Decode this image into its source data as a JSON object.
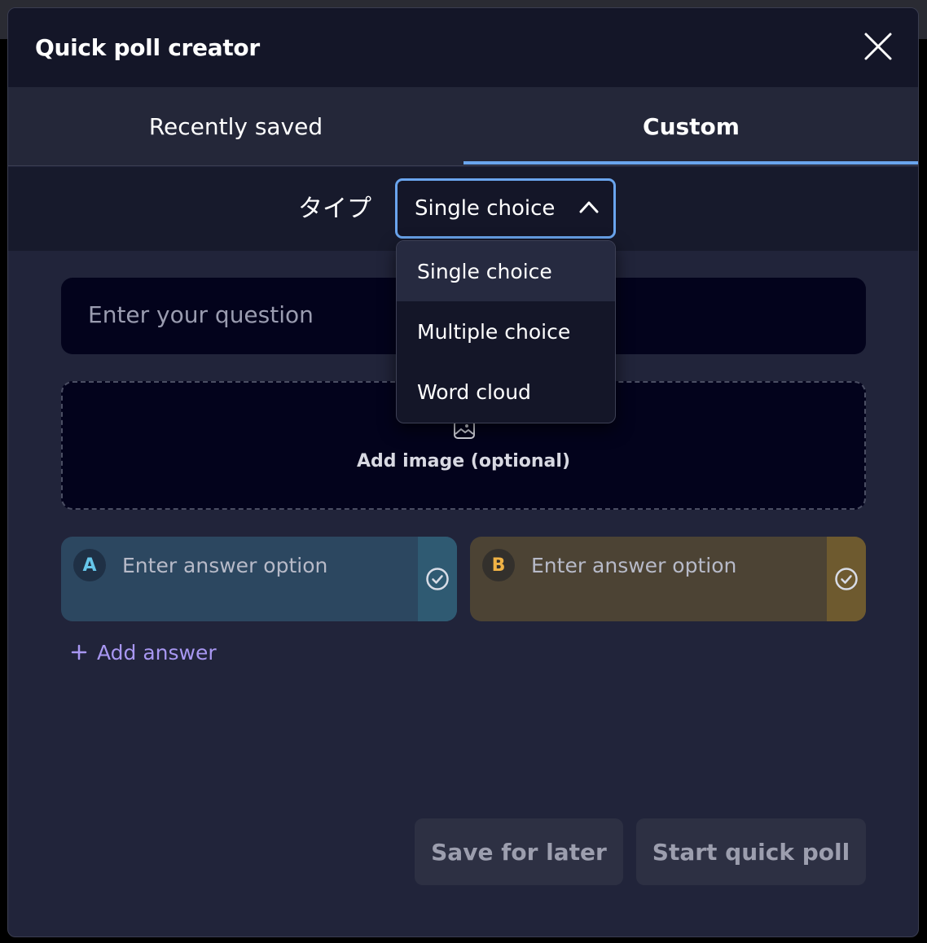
{
  "modal": {
    "title": "Quick poll creator"
  },
  "tabs": [
    {
      "label": "Recently saved",
      "active": false
    },
    {
      "label": "Custom",
      "active": true
    }
  ],
  "type_selector": {
    "label": "タイプ",
    "value": "Single choice",
    "options": [
      "Single choice",
      "Multiple choice",
      "Word cloud"
    ]
  },
  "question": {
    "placeholder": "Enter your question"
  },
  "image_upload": {
    "label": "Add image (optional)"
  },
  "answers": [
    {
      "badge": "A",
      "placeholder": "Enter answer option",
      "color": "#2c4760"
    },
    {
      "badge": "B",
      "placeholder": "Enter answer option",
      "color": "#4c4334"
    }
  ],
  "add_answer": {
    "icon": "plus-icon",
    "label": "Add answer"
  },
  "footer": {
    "save_label": "Save for later",
    "start_label": "Start quick poll"
  },
  "colors": {
    "accent": "#6aa5ee",
    "link": "#a897f2",
    "background": "#21243a"
  }
}
